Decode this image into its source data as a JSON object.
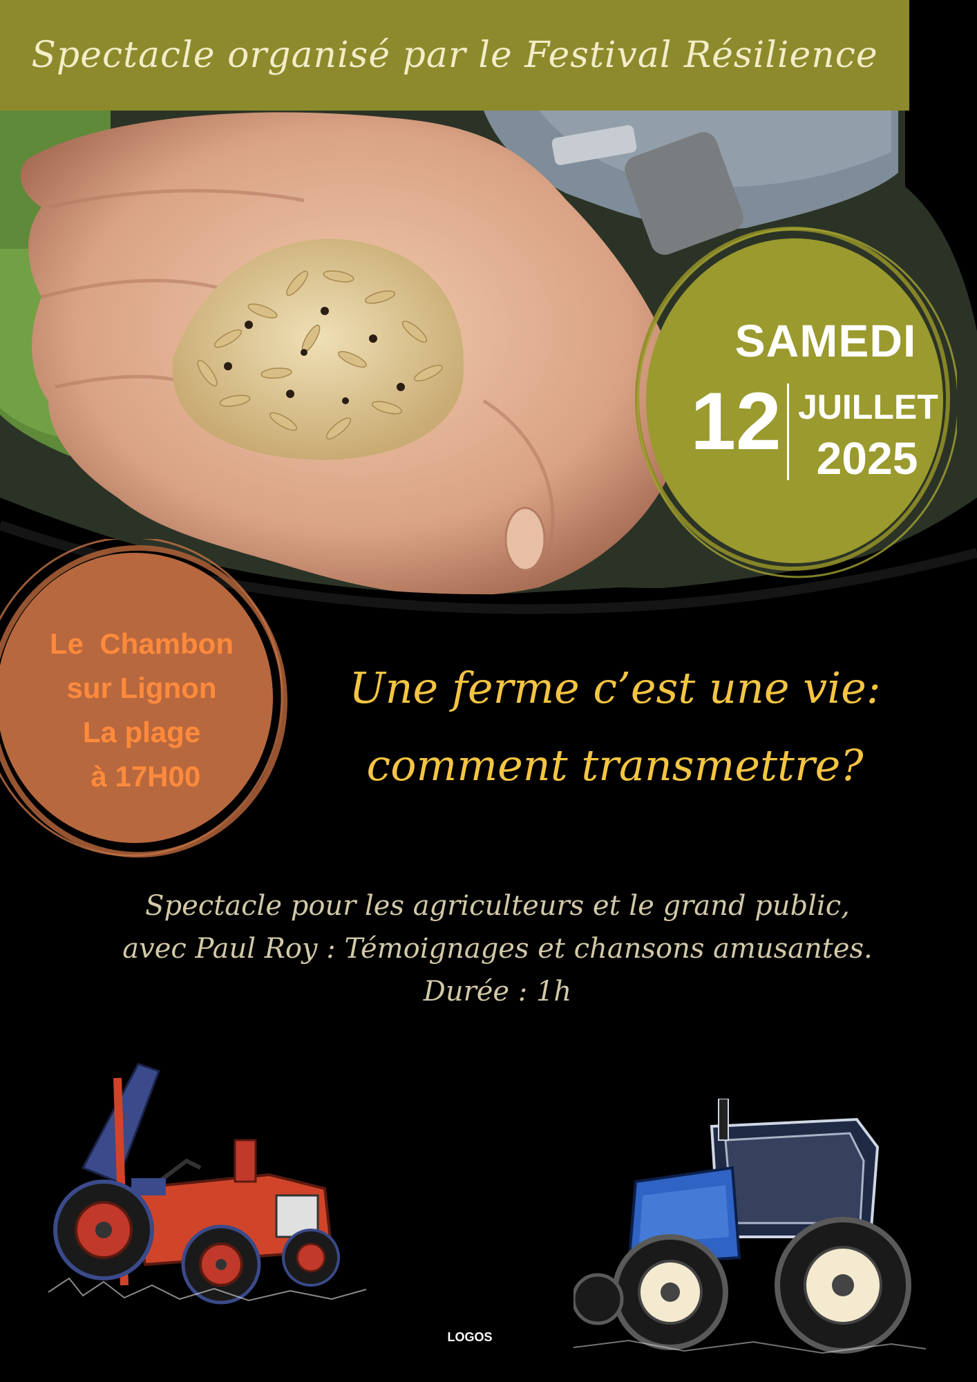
{
  "banner": {
    "text": "Spectacle organisé par le Festival Résilience",
    "color": "#8c8a2c"
  },
  "photo": {
    "subject": "hands holding grain seeds"
  },
  "date": {
    "day_name": "SAMEDI",
    "day_number": "12",
    "month": "JUILLET",
    "year": "2025",
    "circle_color": "#9a9a2e"
  },
  "location": {
    "lines": [
      "Le  Chambon",
      "sur Lignon",
      "La plage",
      " à 17H00"
    ],
    "circle_color": "#b8683e",
    "text_color": "#ff8a3c"
  },
  "headline": {
    "line1": "Une ferme c’est une vie:",
    "line2": "comment transmettre?",
    "color": "#f5c542"
  },
  "description": {
    "line1": "Spectacle pour les agriculteurs et le grand public,",
    "line2": "avec Paul Roy : Témoignages et chansons amusantes.",
    "line3": "Durée : 1h"
  },
  "illustrations": {
    "left": "red vintage tractor",
    "right": "blue modern tractor"
  },
  "footer": {
    "logos_label": "LOGOS"
  }
}
